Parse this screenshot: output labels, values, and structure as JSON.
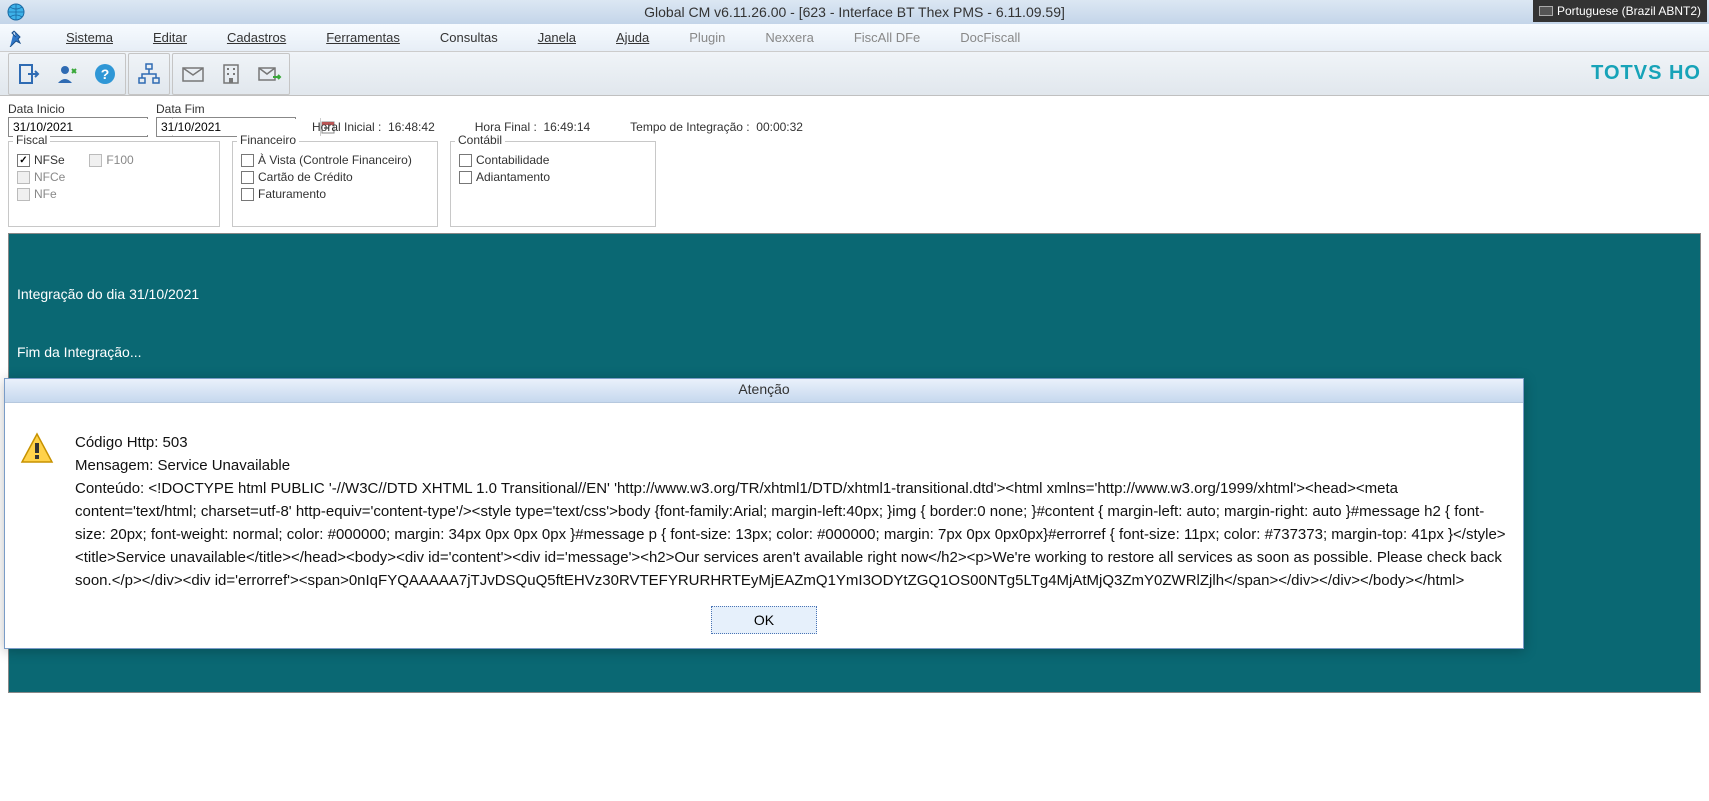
{
  "title": "Global CM v6.11.26.00 - [623 - Interface BT Thex PMS - 6.11.09.59]",
  "language_indicator": "Portuguese (Brazil ABNT2)",
  "menu": {
    "sistema": "Sistema",
    "editar": "Editar",
    "cadastros": "Cadastros",
    "ferramentas": "Ferramentas",
    "consultas": "Consultas",
    "janela": "Janela",
    "ajuda": "Ajuda",
    "plugin": "Plugin",
    "nexxera": "Nexxera",
    "fiscall_dfe": "FiscAll DFe",
    "docfiscall": "DocFiscall"
  },
  "brand": "TOTVS HO",
  "form": {
    "data_inicio_label": "Data Inicio",
    "data_inicio_value": "31/10/2021",
    "data_fim_label": "Data Fim",
    "data_fim_value": "31/10/2021",
    "hora_inicial_label": "Horal Inicial :",
    "hora_inicial_value": "16:48:42",
    "hora_final_label": "Hora Final :",
    "hora_final_value": "16:49:14",
    "tempo_integracao_label": "Tempo de Integração :",
    "tempo_integracao_value": "00:00:32"
  },
  "groups": {
    "fiscal": {
      "legend": "Fiscal",
      "nfse": "NFSe",
      "nfce": "NFCe",
      "nfe": "NFe",
      "f100": "F100"
    },
    "financeiro": {
      "legend": "Financeiro",
      "avista": "À Vista (Controle Financeiro)",
      "cartao": "Cartão de Crédito",
      "faturamento": "Faturamento"
    },
    "contabil": {
      "legend": "Contábil",
      "contabilidade": "Contabilidade",
      "adiantamento": "Adiantamento"
    }
  },
  "log": {
    "line1": "Integração do dia 31/10/2021",
    "line2": "Fim da Integração..."
  },
  "modal": {
    "title": "Atenção",
    "ok": "OK",
    "http_line": "Código Http: 503",
    "msg_line": "Mensagem: Service Unavailable",
    "content_line": "Conteúdo: <!DOCTYPE html PUBLIC '-//W3C//DTD XHTML 1.0 Transitional//EN' 'http://www.w3.org/TR/xhtml1/DTD/xhtml1-transitional.dtd'><html xmlns='http://www.w3.org/1999/xhtml'><head><meta content='text/html; charset=utf-8' http-equiv='content-type'/><style type='text/css'>body {font-family:Arial; margin-left:40px; }img  { border:0 none; }#content { margin-left: auto; margin-right: auto }#message h2 { font-size: 20px; font-weight: normal; color: #000000; margin: 34px 0px 0px 0px }#message p  { font-size: 13px; color: #000000; margin: 7px 0px 0px0px}#errorref { font-size: 11px; color: #737373; margin-top: 41px }</style><title>Service unavailable</title></head><body><div id='content'><div id='message'><h2>Our services aren't available right now</h2><p>We're working to restore all services as soon as possible. Please check back soon.</p></div><div id='errorref'><span>0nIqFYQAAAAA7jTJvDSQuQ5ftEHVz30RVTEFYRURHRTEyMjEAZmQ1YmI3ODYtZGQ1OS00NTg5LTg4MjAtMjQ3ZmY0ZWRlZjlh</span></div></div></body></html>"
  }
}
